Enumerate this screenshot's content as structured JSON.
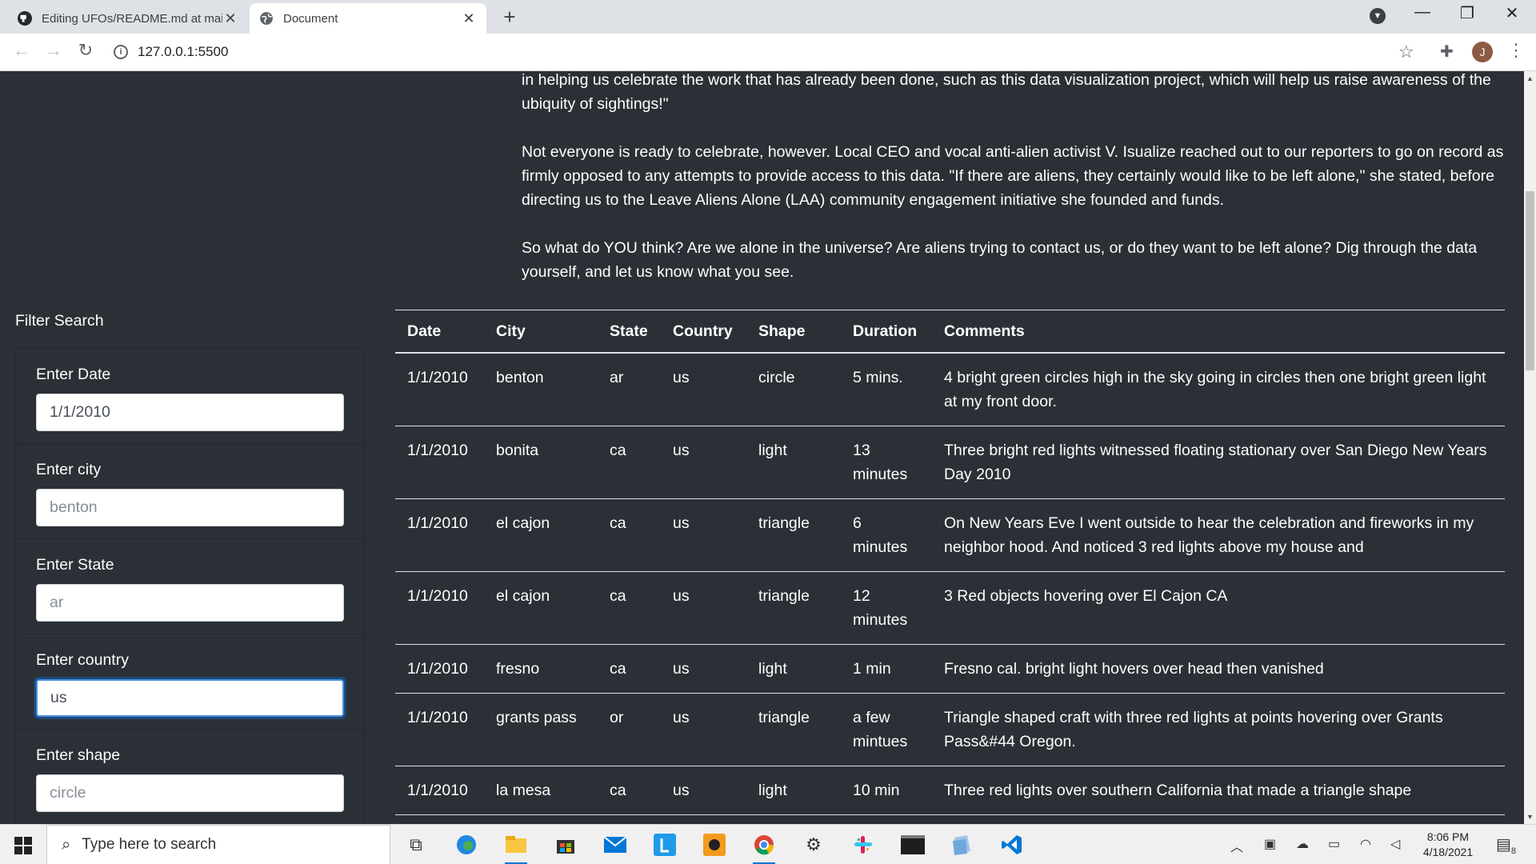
{
  "browser": {
    "tabs": [
      {
        "title": "Editing UFOs/README.md at main",
        "active": false
      },
      {
        "title": "Document",
        "active": true
      }
    ],
    "new_tab": "+",
    "address": "127.0.0.1:5500",
    "profile_initial": "J"
  },
  "article": {
    "paragraphs": [
      "sightings. Citizen scientists can be especially helpful in both cataloguing sightings—which is hugely helpful for us in our search for aliens—and in helping us celebrate the work that has already been done, such as this data visualization project, which will help us raise awareness of the ubiquity of sightings!\"",
      "Not everyone is ready to celebrate, however. Local CEO and vocal anti-alien activist V. Isualize reached out to our reporters to go on record as firmly opposed to any attempts to provide access to this data. \"If there are aliens, they certainly would like to be left alone,\" she stated, before directing us to the Leave Aliens Alone (LAA) community engagement initiative she founded and funds.",
      "So what do YOU think? Are we alone in the universe? Are aliens trying to contact us, or do they want to be left alone? Dig through the data yourself, and let us know what you see."
    ]
  },
  "filters": {
    "title": "Filter Search",
    "date": {
      "label": "Enter Date",
      "value": "1/1/2010"
    },
    "city": {
      "label": "Enter city",
      "placeholder": "benton"
    },
    "state": {
      "label": "Enter State",
      "placeholder": "ar"
    },
    "country": {
      "label": "Enter country",
      "value": "us"
    },
    "shape": {
      "label": "Enter shape",
      "placeholder": "circle"
    }
  },
  "table": {
    "headers": [
      "Date",
      "City",
      "State",
      "Country",
      "Shape",
      "Duration",
      "Comments"
    ],
    "rows": [
      [
        "1/1/2010",
        "benton",
        "ar",
        "us",
        "circle",
        "5 mins.",
        "4 bright green circles high in the sky going in circles then one bright green light at my front door."
      ],
      [
        "1/1/2010",
        "bonita",
        "ca",
        "us",
        "light",
        "13 minutes",
        "Three bright red lights witnessed floating stationary over San Diego New Years Day 2010"
      ],
      [
        "1/1/2010",
        "el cajon",
        "ca",
        "us",
        "triangle",
        "6 minutes",
        "On New Years Eve I went outside to hear the celebration and fireworks in my neighbor hood. And noticed 3 red lights above my house and"
      ],
      [
        "1/1/2010",
        "el cajon",
        "ca",
        "us",
        "triangle",
        "12 minutes",
        "3 Red objects hovering over El Cajon CA"
      ],
      [
        "1/1/2010",
        "fresno",
        "ca",
        "us",
        "light",
        "1 min",
        "Fresno cal. bright light hovers over head then vanished"
      ],
      [
        "1/1/2010",
        "grants pass",
        "or",
        "us",
        "triangle",
        "a few mintues",
        "Triangle shaped craft with three red lights at points hovering over Grants Pass&#44 Oregon."
      ],
      [
        "1/1/2010",
        "la mesa",
        "ca",
        "us",
        "light",
        "10 min",
        "Three red lights over southern California that made a triangle shape"
      ]
    ]
  },
  "taskbar": {
    "search_placeholder": "Type here to search",
    "time": "8:06 PM",
    "date": "4/18/2021",
    "notification_count": "8",
    "apps": [
      "task-view",
      "edge",
      "file-explorer",
      "store",
      "mail",
      "l-app",
      "paint-app",
      "chrome",
      "settings",
      "slack",
      "terminal",
      "files",
      "vscode"
    ]
  },
  "colors": {
    "page_bg": "#2b3036",
    "accent": "#0078d7"
  }
}
